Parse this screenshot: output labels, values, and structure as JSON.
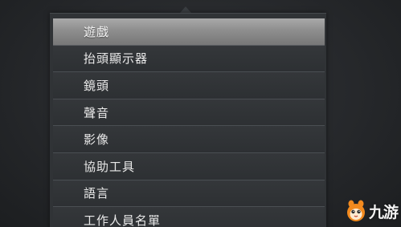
{
  "menu": {
    "selected_index": 0,
    "items": [
      {
        "label": "遊戲"
      },
      {
        "label": "抬頭顯示器"
      },
      {
        "label": "鏡頭"
      },
      {
        "label": "聲音"
      },
      {
        "label": "影像"
      },
      {
        "label": "協助工具"
      },
      {
        "label": "語言"
      },
      {
        "label": "工作人員名單"
      }
    ]
  },
  "watermark": {
    "text": "九游",
    "icon": "mascot-icon",
    "accent_color": "#f28a1e"
  }
}
